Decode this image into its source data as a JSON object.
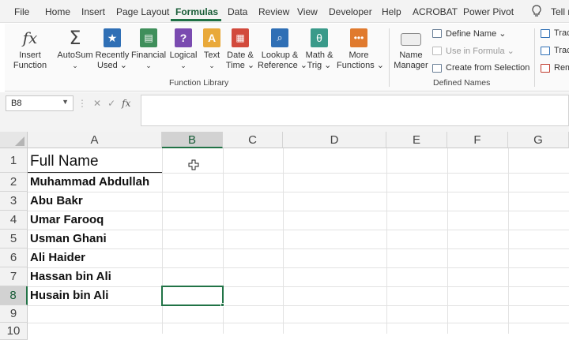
{
  "menu": {
    "items": [
      "File",
      "Home",
      "Insert",
      "Page Layout",
      "Formulas",
      "Data",
      "Review",
      "View",
      "Developer",
      "Help",
      "ACROBAT",
      "Power Pivot",
      "Tell m"
    ],
    "active_index": 4
  },
  "ribbon": {
    "insert_function": {
      "line1": "Insert",
      "line2": "Function"
    },
    "autosum": {
      "line1": "AutoSum",
      "line2": "⌄"
    },
    "recently_used": {
      "line1": "Recently",
      "line2": "Used ⌄"
    },
    "financial": {
      "line1": "Financial",
      "line2": "⌄"
    },
    "logical": {
      "line1": "Logical",
      "line2": "⌄"
    },
    "text": {
      "line1": "Text",
      "line2": "⌄"
    },
    "date_time": {
      "line1": "Date &",
      "line2": "Time ⌄"
    },
    "lookup": {
      "line1": "Lookup &",
      "line2": "Reference ⌄"
    },
    "math": {
      "line1": "Math &",
      "line2": "Trig ⌄"
    },
    "more": {
      "line1": "More",
      "line2": "Functions ⌄"
    },
    "function_library_label": "Function Library",
    "name_manager": {
      "line1": "Name",
      "line2": "Manager"
    },
    "define_name": "Define Name ⌄",
    "use_in_formula": "Use in Formula ⌄",
    "create_from_selection": "Create from Selection",
    "defined_names_label": "Defined Names",
    "trace1": "Trac",
    "trace2": "Trac",
    "remove": "Rem"
  },
  "formula_bar": {
    "name_box": "B8",
    "formula": ""
  },
  "grid": {
    "columns": [
      "A",
      "B",
      "C",
      "D",
      "E",
      "F",
      "G"
    ],
    "selected_column": "B",
    "rows": [
      "1",
      "2",
      "3",
      "4",
      "5",
      "6",
      "7",
      "8",
      "9",
      "10"
    ],
    "selected_row": "8",
    "cells": {
      "A1": "Full Name",
      "A2": "Muhammad Abdullah",
      "A3": "Abu Bakr",
      "A4": "Umar Farooq",
      "A5": "Usman Ghani",
      "A6": "Ali Haider",
      "A7": "Hassan bin Ali",
      "A8": "Husain bin Ali"
    }
  },
  "colors": {
    "excel_green": "#217346",
    "tab_green": "#185c37"
  }
}
